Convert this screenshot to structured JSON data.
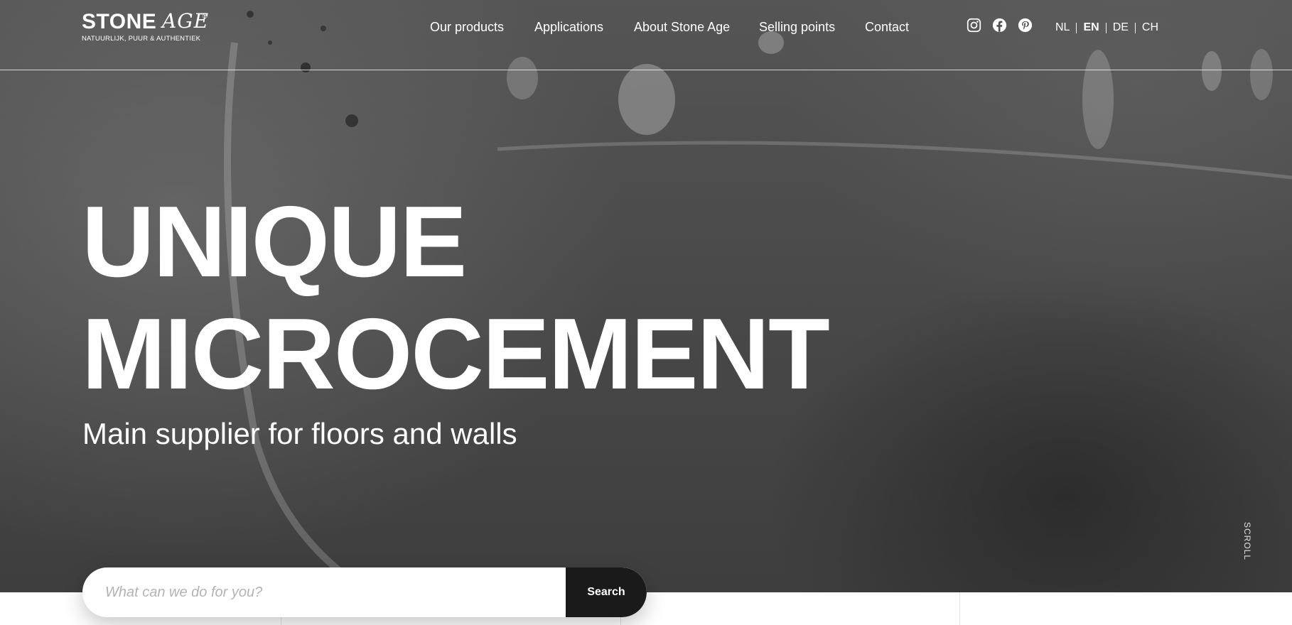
{
  "brand": {
    "name": "STONE",
    "script": "AGE",
    "registered": "®",
    "tagline": "NATUURLIJK, PUUR & AUTHENTIEK"
  },
  "nav": {
    "items": [
      {
        "label": "Our products"
      },
      {
        "label": "Applications"
      },
      {
        "label": "About Stone Age"
      },
      {
        "label": "Selling points"
      },
      {
        "label": "Contact"
      }
    ]
  },
  "social": {
    "icons": [
      "instagram-icon",
      "facebook-icon",
      "pinterest-icon"
    ]
  },
  "languages": {
    "items": [
      {
        "code": "NL",
        "active": false
      },
      {
        "code": "EN",
        "active": true
      },
      {
        "code": "DE",
        "active": false
      },
      {
        "code": "CH",
        "active": false
      }
    ]
  },
  "hero": {
    "headline_line1": "UNIQUE",
    "headline_line2": "MICROCEMENT",
    "subtitle": "Main supplier for floors and walls",
    "scroll_label": "SCROLL"
  },
  "search": {
    "placeholder": "What can we do for you?",
    "value": "",
    "button_label": "Search"
  },
  "colors": {
    "text": "#ffffff",
    "search_button": "#1a1a1a",
    "hero_base": "#4a4a4a"
  }
}
